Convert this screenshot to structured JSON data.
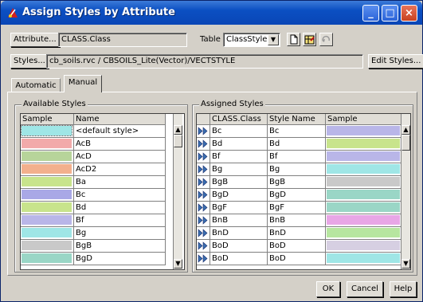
{
  "window": {
    "title": "Assign Styles by Attribute"
  },
  "toolbar": {
    "attribute_button": "Attribute...",
    "attribute_value": "CLASS.Class",
    "table_label": "Table",
    "table_value": "ClassStyle",
    "styles_button": "Styles...",
    "styles_value": "cb_soils.rvc / CBSOILS_Lite(Vector)/VECTSTYLE",
    "edit_styles_button": "Edit Styles..."
  },
  "tabs": [
    {
      "label": "Automatic"
    },
    {
      "label": "Manual"
    }
  ],
  "available": {
    "title": "Available Styles",
    "col_sample": "Sample",
    "col_name": "Name",
    "rows": [
      {
        "name": "<default style>",
        "color": "#9fe6e6"
      },
      {
        "name": "AcB",
        "color": "#f2aaaa"
      },
      {
        "name": "AcD",
        "color": "#b7d49a"
      },
      {
        "name": "AcD2",
        "color": "#f3b08d"
      },
      {
        "name": "Ba",
        "color": "#c8e48c"
      },
      {
        "name": "Bc",
        "color": "#a9a8e6"
      },
      {
        "name": "Bd",
        "color": "#c8e48c"
      },
      {
        "name": "Bf",
        "color": "#b9b6e8"
      },
      {
        "name": "Bg",
        "color": "#9fe6e6"
      },
      {
        "name": "BgB",
        "color": "#c9c9c9"
      },
      {
        "name": "BgD",
        "color": "#9ad6c6"
      }
    ]
  },
  "assigned": {
    "title": "Assigned Styles",
    "col_class": "CLASS.Class",
    "col_style": "Style Name",
    "col_sample": "Sample",
    "rows": [
      {
        "cls": "Bc",
        "style": "Bc",
        "color": "#b9b6e8"
      },
      {
        "cls": "Bd",
        "style": "Bd",
        "color": "#c8e48c"
      },
      {
        "cls": "Bf",
        "style": "Bf",
        "color": "#b9b6e8"
      },
      {
        "cls": "Bg",
        "style": "Bg",
        "color": "#9fe6e6"
      },
      {
        "cls": "BgB",
        "style": "BgB",
        "color": "#c9c9c9"
      },
      {
        "cls": "BgD",
        "style": "BgD",
        "color": "#9ad6c6"
      },
      {
        "cls": "BgF",
        "style": "BgF",
        "color": "#9ad6c6"
      },
      {
        "cls": "BnB",
        "style": "BnB",
        "color": "#e8a6e6"
      },
      {
        "cls": "BnD",
        "style": "BnD",
        "color": "#b7e6a0"
      },
      {
        "cls": "BoD",
        "style": "BoD",
        "color": "#d6cfe2"
      },
      {
        "cls": "BoD",
        "style": "BoD",
        "color": "#9fe6e6"
      }
    ]
  },
  "buttons": {
    "ok": "OK",
    "cancel": "Cancel",
    "help": "Help"
  }
}
